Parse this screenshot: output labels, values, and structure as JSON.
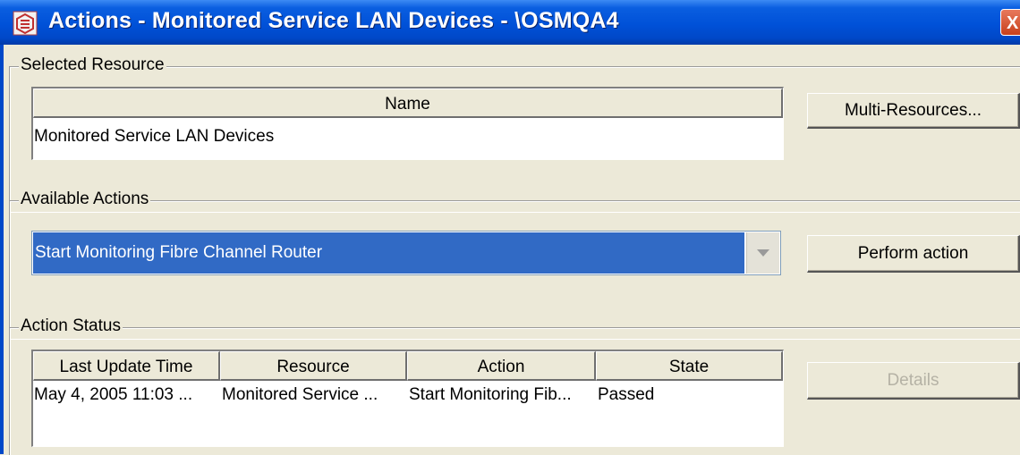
{
  "window": {
    "title": "Actions - Monitored Service LAN Devices - \\OSMQA4",
    "icon": "app-icon",
    "close_label": "X"
  },
  "selected_resource": {
    "group_title": "Selected Resource",
    "columns": [
      "Name"
    ],
    "rows": [
      [
        "Monitored Service LAN Devices"
      ]
    ],
    "multi_resources_label": "Multi-Resources..."
  },
  "available_actions": {
    "group_title": "Available Actions",
    "selected_action": "Start Monitoring Fibre Channel Router",
    "perform_label": "Perform action"
  },
  "action_status": {
    "group_title": "Action Status",
    "columns": [
      "Last Update Time",
      "Resource",
      "Action",
      "State"
    ],
    "rows": [
      [
        "May 4, 2005 11:03 ...",
        "Monitored Service ...",
        "Start Monitoring Fib...",
        "Passed"
      ]
    ],
    "details_label": "Details"
  },
  "colors": {
    "titlebar": "#0051d8",
    "selection": "#316ac5",
    "window_bg": "#ece9d8"
  }
}
